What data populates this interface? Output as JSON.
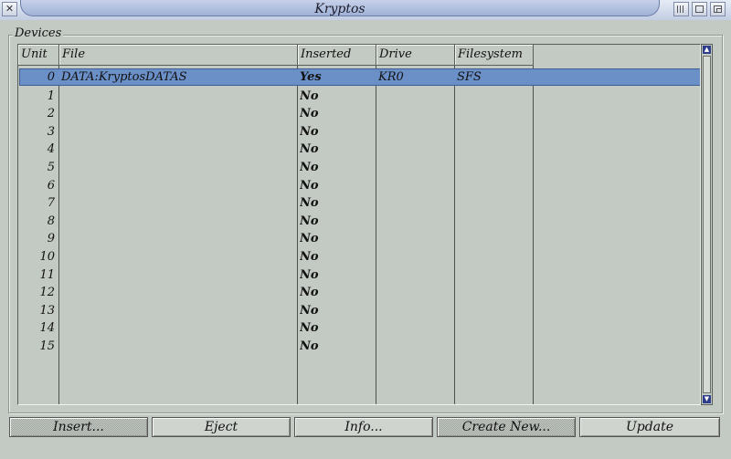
{
  "window": {
    "title": "Kryptos"
  },
  "icons": {
    "close": "close-icon",
    "iconify": "iconify-icon",
    "zoom": "zoom-icon",
    "depth": "depth-icon"
  },
  "group": {
    "label": "Devices"
  },
  "columns": [
    {
      "key": "unit",
      "label": "Unit"
    },
    {
      "key": "file",
      "label": "File"
    },
    {
      "key": "inserted",
      "label": "Inserted"
    },
    {
      "key": "drive",
      "label": "Drive"
    },
    {
      "key": "filesystem",
      "label": "Filesystem"
    }
  ],
  "rows": [
    {
      "unit": "0",
      "file": "DATA:KryptosDATAS",
      "inserted": "Yes",
      "drive": "KR0",
      "filesystem": "SFS",
      "selected": true
    },
    {
      "unit": "1",
      "file": "",
      "inserted": "No",
      "drive": "",
      "filesystem": ""
    },
    {
      "unit": "2",
      "file": "",
      "inserted": "No",
      "drive": "",
      "filesystem": ""
    },
    {
      "unit": "3",
      "file": "",
      "inserted": "No",
      "drive": "",
      "filesystem": ""
    },
    {
      "unit": "4",
      "file": "",
      "inserted": "No",
      "drive": "",
      "filesystem": ""
    },
    {
      "unit": "5",
      "file": "",
      "inserted": "No",
      "drive": "",
      "filesystem": ""
    },
    {
      "unit": "6",
      "file": "",
      "inserted": "No",
      "drive": "",
      "filesystem": ""
    },
    {
      "unit": "7",
      "file": "",
      "inserted": "No",
      "drive": "",
      "filesystem": ""
    },
    {
      "unit": "8",
      "file": "",
      "inserted": "No",
      "drive": "",
      "filesystem": ""
    },
    {
      "unit": "9",
      "file": "",
      "inserted": "No",
      "drive": "",
      "filesystem": ""
    },
    {
      "unit": "10",
      "file": "",
      "inserted": "No",
      "drive": "",
      "filesystem": ""
    },
    {
      "unit": "11",
      "file": "",
      "inserted": "No",
      "drive": "",
      "filesystem": ""
    },
    {
      "unit": "12",
      "file": "",
      "inserted": "No",
      "drive": "",
      "filesystem": ""
    },
    {
      "unit": "13",
      "file": "",
      "inserted": "No",
      "drive": "",
      "filesystem": ""
    },
    {
      "unit": "14",
      "file": "",
      "inserted": "No",
      "drive": "",
      "filesystem": ""
    },
    {
      "unit": "15",
      "file": "",
      "inserted": "No",
      "drive": "",
      "filesystem": ""
    }
  ],
  "buttons": {
    "insert": "Insert...",
    "eject": "Eject",
    "info": "Info...",
    "create_new": "Create New...",
    "update": "Update"
  },
  "colors": {
    "selection": "#6b90c8",
    "background": "#c3c9c3",
    "titlebar": "#b8c5e0"
  }
}
